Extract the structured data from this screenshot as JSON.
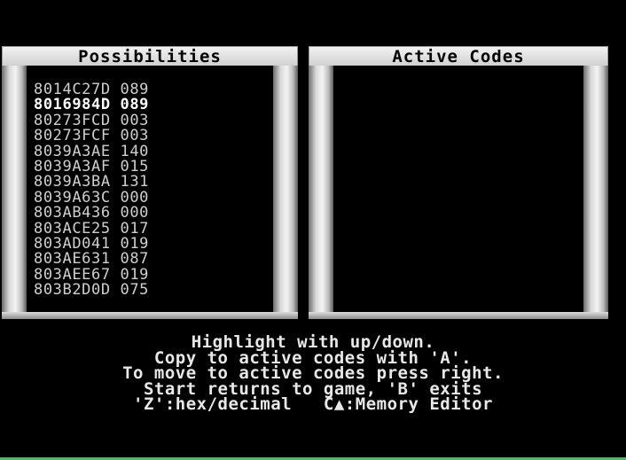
{
  "possibilities": {
    "title": "Possibilities",
    "selected_index": 1,
    "items": [
      "8014C27D 089",
      "8016984D 089",
      "80273FCD 003",
      "80273FCF 003",
      "8039A3AE 140",
      "8039A3AF 015",
      "8039A3BA 131",
      "8039A63C 000",
      "803AB436 000",
      "803ACE25 017",
      "803AD041 019",
      "803AE631 087",
      "803AEE67 019",
      "803B2D0D 075"
    ]
  },
  "active_codes": {
    "title": "Active Codes",
    "items": []
  },
  "help": {
    "line1": "Highlight with up/down.",
    "line2": "Copy to active codes with 'A'.",
    "line3": "To move to active codes press right.",
    "line4": "Start returns to game, 'B' exits",
    "line5": "'Z':hex/decimal   C▲:Memory Editor"
  }
}
